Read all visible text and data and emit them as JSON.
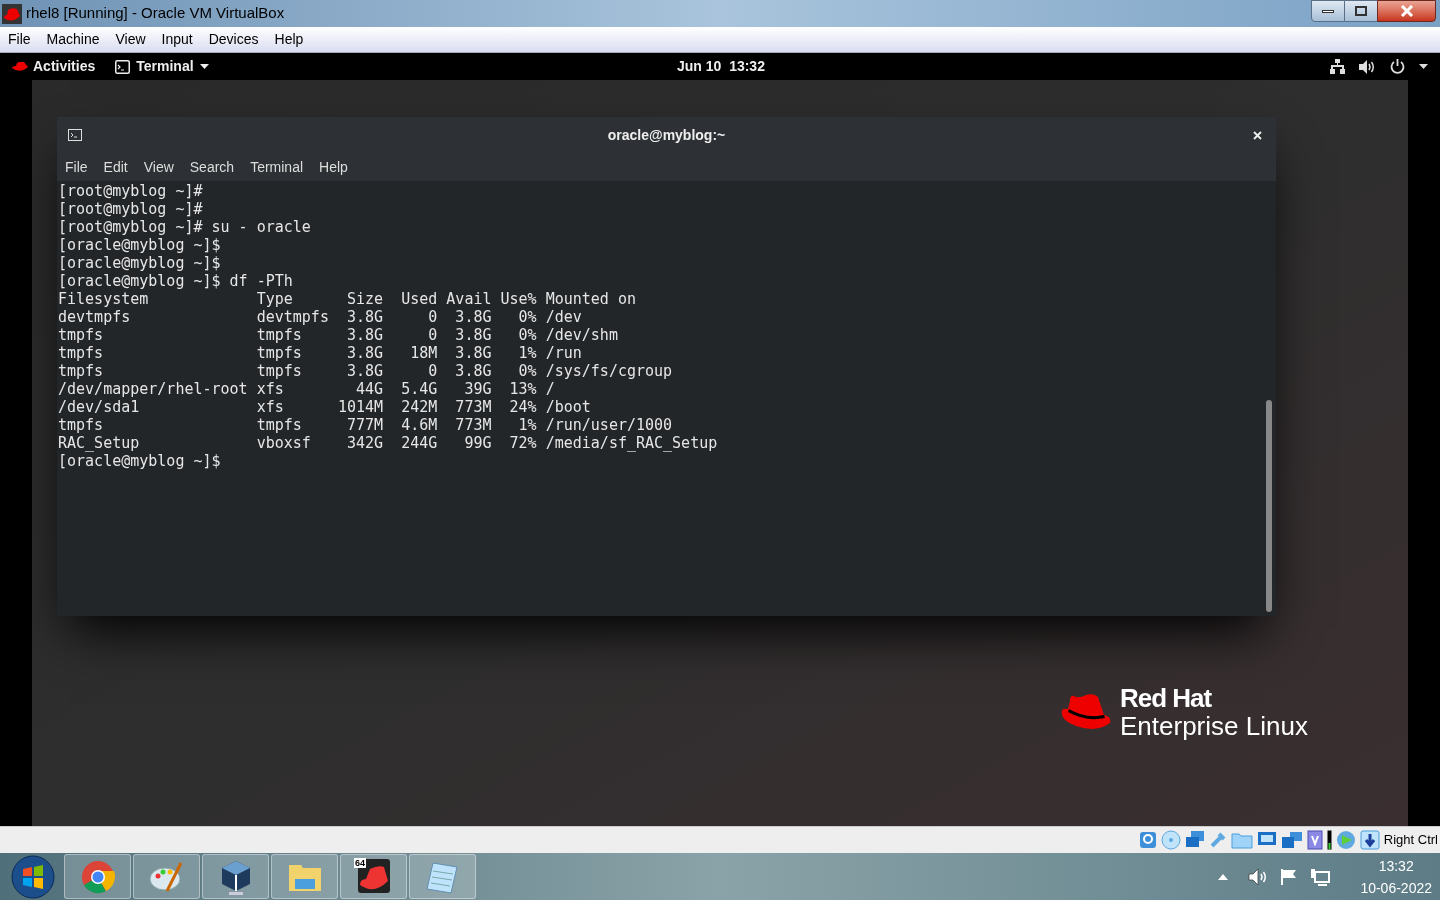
{
  "window": {
    "title": "rhel8 [Running] - Oracle VM VirtualBox"
  },
  "menu": [
    "File",
    "Machine",
    "View",
    "Input",
    "Devices",
    "Help"
  ],
  "gnome_bar": {
    "activities": "Activities",
    "app": "Terminal",
    "clock": "Jun 10  13:32"
  },
  "terminal": {
    "title": "oracle@myblog:~",
    "menu": [
      "File",
      "Edit",
      "View",
      "Search",
      "Terminal",
      "Help"
    ],
    "lines": [
      "[root@myblog ~]#",
      "[root@myblog ~]#",
      "[root@myblog ~]# su - oracle",
      "[oracle@myblog ~]$",
      "[oracle@myblog ~]$",
      "[oracle@myblog ~]$ df -PTh",
      "Filesystem            Type      Size  Used Avail Use% Mounted on",
      "devtmpfs              devtmpfs  3.8G     0  3.8G   0% /dev",
      "tmpfs                 tmpfs     3.8G     0  3.8G   0% /dev/shm",
      "tmpfs                 tmpfs     3.8G   18M  3.8G   1% /run",
      "tmpfs                 tmpfs     3.8G     0  3.8G   0% /sys/fs/cgroup",
      "/dev/mapper/rhel-root xfs        44G  5.4G   39G  13% /",
      "/dev/sda1             xfs      1014M  242M  773M  24% /boot",
      "tmpfs                 tmpfs     777M  4.6M  773M   1% /run/user/1000",
      "RAC_Setup             vboxsf    342G  244G   99G  72% /media/sf_RAC_Setup",
      "[oracle@myblog ~]$"
    ]
  },
  "logo": {
    "line1": "Red Hat",
    "line2": "Enterprise Linux"
  },
  "status_bar": {
    "host_key": "Right Ctrl"
  },
  "taskbar": {
    "apps": [
      {
        "kind": "browser"
      },
      {
        "kind": "paint"
      },
      {
        "kind": "box"
      },
      {
        "kind": "folder"
      },
      {
        "kind": "hat",
        "badge": "64"
      },
      {
        "kind": "notepad"
      }
    ],
    "time": "13:32",
    "date": "10-06-2022"
  }
}
